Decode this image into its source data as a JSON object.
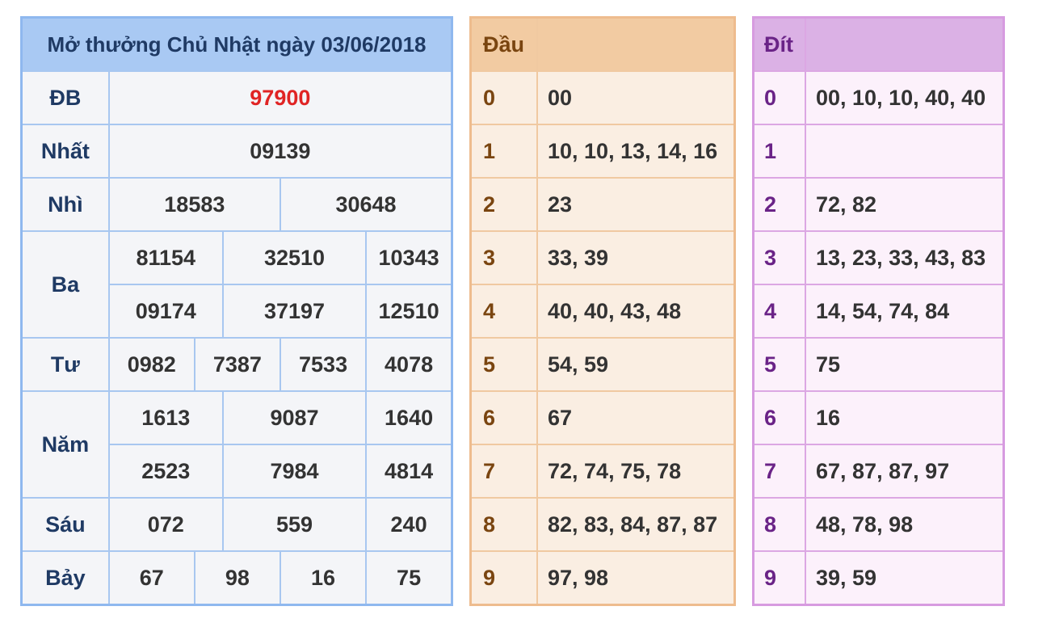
{
  "results": {
    "title": "Mở thưởng Chủ Nhật ngày 03/06/2018",
    "rows": [
      {
        "label": "ĐB",
        "values": [
          "97900"
        ]
      },
      {
        "label": "Nhất",
        "values": [
          "09139"
        ]
      },
      {
        "label": "Nhì",
        "values": [
          "18583",
          "30648"
        ]
      },
      {
        "label": "Ba",
        "values": [
          "81154",
          "32510",
          "10343",
          "09174",
          "37197",
          "12510"
        ]
      },
      {
        "label": "Tư",
        "values": [
          "0982",
          "7387",
          "7533",
          "4078"
        ]
      },
      {
        "label": "Năm",
        "values": [
          "1613",
          "9087",
          "1640",
          "2523",
          "7984",
          "4814"
        ]
      },
      {
        "label": "Sáu",
        "values": [
          "072",
          "559",
          "240"
        ]
      },
      {
        "label": "Bảy",
        "values": [
          "67",
          "98",
          "16",
          "75"
        ]
      }
    ],
    "special_color": "#e02424"
  },
  "dau": {
    "header": "Đầu",
    "rows": [
      {
        "key": "0",
        "value": "00"
      },
      {
        "key": "1",
        "value": "10, 10, 13, 14, 16"
      },
      {
        "key": "2",
        "value": "23"
      },
      {
        "key": "3",
        "value": "33, 39"
      },
      {
        "key": "4",
        "value": "40, 40, 43, 48"
      },
      {
        "key": "5",
        "value": "54, 59"
      },
      {
        "key": "6",
        "value": "67"
      },
      {
        "key": "7",
        "value": "72, 74, 75, 78"
      },
      {
        "key": "8",
        "value": "82, 83, 84, 87, 87"
      },
      {
        "key": "9",
        "value": "97, 98"
      }
    ]
  },
  "dit": {
    "header": "Đít",
    "rows": [
      {
        "key": "0",
        "value": "00, 10, 10, 40, 40"
      },
      {
        "key": "1",
        "value": ""
      },
      {
        "key": "2",
        "value": "72, 82"
      },
      {
        "key": "3",
        "value": "13, 23, 33, 43, 83"
      },
      {
        "key": "4",
        "value": "14, 54, 74, 84"
      },
      {
        "key": "5",
        "value": "75"
      },
      {
        "key": "6",
        "value": "16"
      },
      {
        "key": "7",
        "value": "67, 87, 87, 97"
      },
      {
        "key": "8",
        "value": "48, 78, 98"
      },
      {
        "key": "9",
        "value": "39, 59"
      }
    ]
  }
}
